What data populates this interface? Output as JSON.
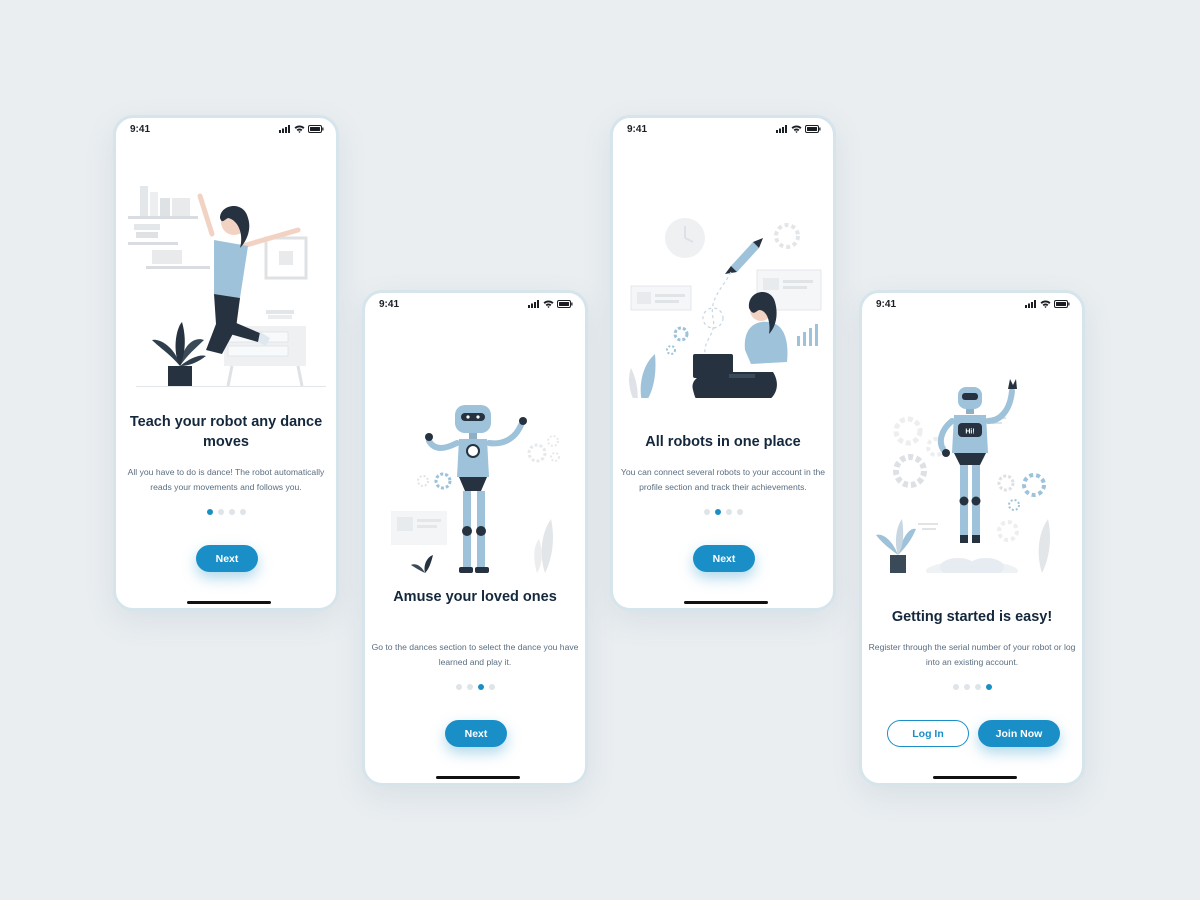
{
  "colors": {
    "background": "#eaeef1",
    "accent": "#1a8fc7",
    "title_text": "#14283d",
    "body_text": "#5a6e80",
    "dot_inactive": "#dfe4e8",
    "illustration_blue": "#9ec2d9",
    "illustration_dark": "#26323f"
  },
  "screens": [
    {
      "time": "9:41",
      "illustration": "woman-jumping-illustration",
      "title": "Teach your robot any dance moves",
      "description": "All you have to do is dance! The robot automatically reads your movements and follows you.",
      "active_dot": 1,
      "button": "Next"
    },
    {
      "time": "9:41",
      "illustration": "dancing-robot-illustration",
      "title": "Amuse your loved ones",
      "description": "Go to the dances section to select the dance you have learned and play it.",
      "active_dot": 3,
      "button": "Next"
    },
    {
      "time": "9:41",
      "illustration": "woman-laptop-illustration",
      "title": "All robots in one place",
      "description": "You can connect several robots to your account in the profile section and track their achievements.",
      "active_dot": 2,
      "button": "Next"
    },
    {
      "time": "9:41",
      "illustration": "waving-robot-illustration",
      "robot_badge": "Hi!",
      "title": "Getting started is easy!",
      "description": "Register through the serial number of your robot or log into an existing account.",
      "active_dot": 4,
      "login_button": "Log In",
      "join_button": "Join Now"
    }
  ]
}
